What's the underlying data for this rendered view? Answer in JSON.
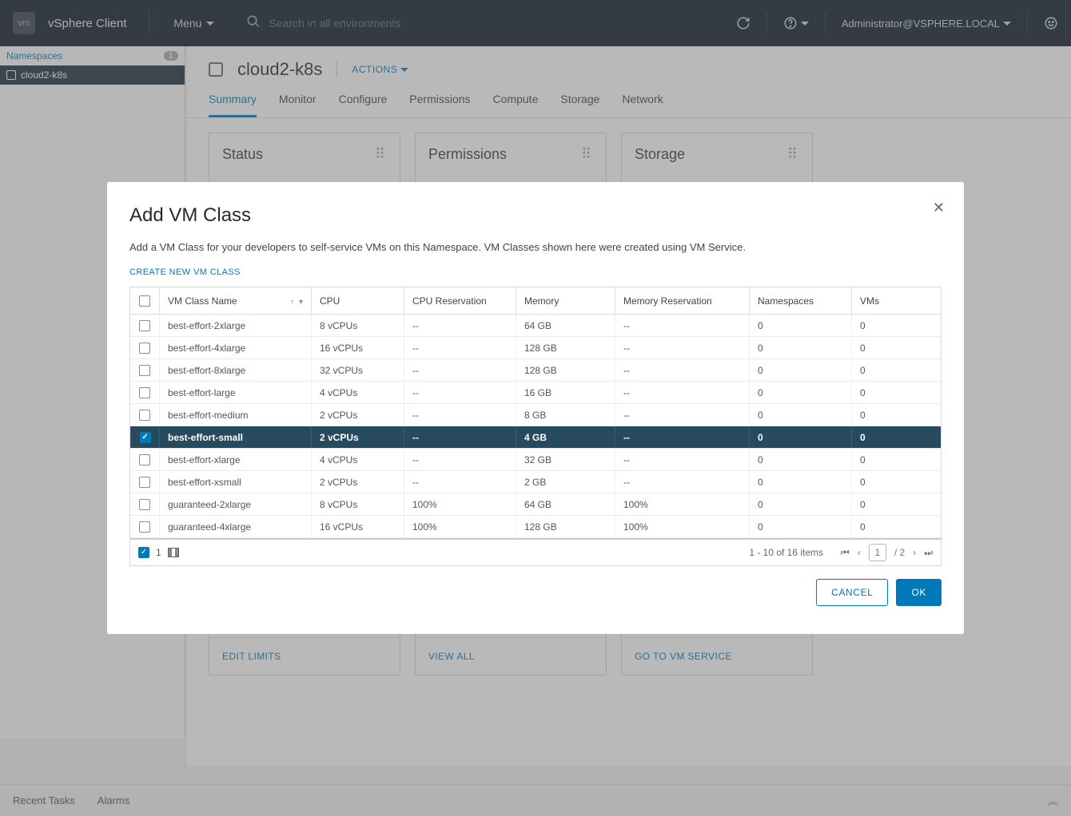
{
  "topbar": {
    "app_title": "vSphere Client",
    "menu_label": "Menu",
    "search_placeholder": "Search in all environments",
    "user_label": "Administrator@VSPHERE.LOCAL"
  },
  "left_nav": {
    "root_label": "Namespaces",
    "root_badge": "1",
    "item_label": "cloud2-k8s"
  },
  "main": {
    "title": "cloud2-k8s",
    "actions_label": "ACTIONS",
    "tabs": {
      "summary": "Summary",
      "monitor": "Monitor",
      "configure": "Configure",
      "permissions": "Permissions",
      "compute": "Compute",
      "storage": "Storage",
      "network": "Network"
    },
    "card_status_title": "Status",
    "card_status_action": "EDIT LIMITS",
    "card_permissions_title": "Permissions",
    "card_permissions_action": "VIEW ALL",
    "card_storage_title": "Storage",
    "card_storage_action": "GO TO VM SERVICE"
  },
  "footer": {
    "recent": "Recent Tasks",
    "alarms": "Alarms"
  },
  "modal": {
    "title": "Add VM Class",
    "description": "Add a VM Class for your developers to self-service VMs on this Namespace. VM Classes shown here were created using VM Service.",
    "create_link": "CREATE NEW VM CLASS",
    "columns": {
      "name": "VM Class Name",
      "cpu": "CPU",
      "cpu_res": "CPU Reservation",
      "mem": "Memory",
      "mem_res": "Memory Reservation",
      "ns": "Namespaces",
      "vms": "VMs"
    },
    "rows": [
      {
        "name": "best-effort-2xlarge",
        "cpu": "8 vCPUs",
        "cpu_res": "--",
        "mem": "64 GB",
        "mem_res": "--",
        "ns": "0",
        "vms": "0",
        "selected": false
      },
      {
        "name": "best-effort-4xlarge",
        "cpu": "16 vCPUs",
        "cpu_res": "--",
        "mem": "128 GB",
        "mem_res": "--",
        "ns": "0",
        "vms": "0",
        "selected": false
      },
      {
        "name": "best-effort-8xlarge",
        "cpu": "32 vCPUs",
        "cpu_res": "--",
        "mem": "128 GB",
        "mem_res": "--",
        "ns": "0",
        "vms": "0",
        "selected": false
      },
      {
        "name": "best-effort-large",
        "cpu": "4 vCPUs",
        "cpu_res": "--",
        "mem": "16 GB",
        "mem_res": "--",
        "ns": "0",
        "vms": "0",
        "selected": false
      },
      {
        "name": "best-effort-medium",
        "cpu": "2 vCPUs",
        "cpu_res": "--",
        "mem": "8 GB",
        "mem_res": "--",
        "ns": "0",
        "vms": "0",
        "selected": false
      },
      {
        "name": "best-effort-small",
        "cpu": "2 vCPUs",
        "cpu_res": "--",
        "mem": "4 GB",
        "mem_res": "--",
        "ns": "0",
        "vms": "0",
        "selected": true
      },
      {
        "name": "best-effort-xlarge",
        "cpu": "4 vCPUs",
        "cpu_res": "--",
        "mem": "32 GB",
        "mem_res": "--",
        "ns": "0",
        "vms": "0",
        "selected": false
      },
      {
        "name": "best-effort-xsmall",
        "cpu": "2 vCPUs",
        "cpu_res": "--",
        "mem": "2 GB",
        "mem_res": "--",
        "ns": "0",
        "vms": "0",
        "selected": false
      },
      {
        "name": "guaranteed-2xlarge",
        "cpu": "8 vCPUs",
        "cpu_res": "100%",
        "mem": "64 GB",
        "mem_res": "100%",
        "ns": "0",
        "vms": "0",
        "selected": false
      },
      {
        "name": "guaranteed-4xlarge",
        "cpu": "16 vCPUs",
        "cpu_res": "100%",
        "mem": "128 GB",
        "mem_res": "100%",
        "ns": "0",
        "vms": "0",
        "selected": false
      }
    ],
    "selected_count": "1",
    "pager": {
      "range_text": "1 - 10 of 16 items",
      "current": "1",
      "sep": "/ 2"
    },
    "cancel": "CANCEL",
    "ok": "OK"
  }
}
